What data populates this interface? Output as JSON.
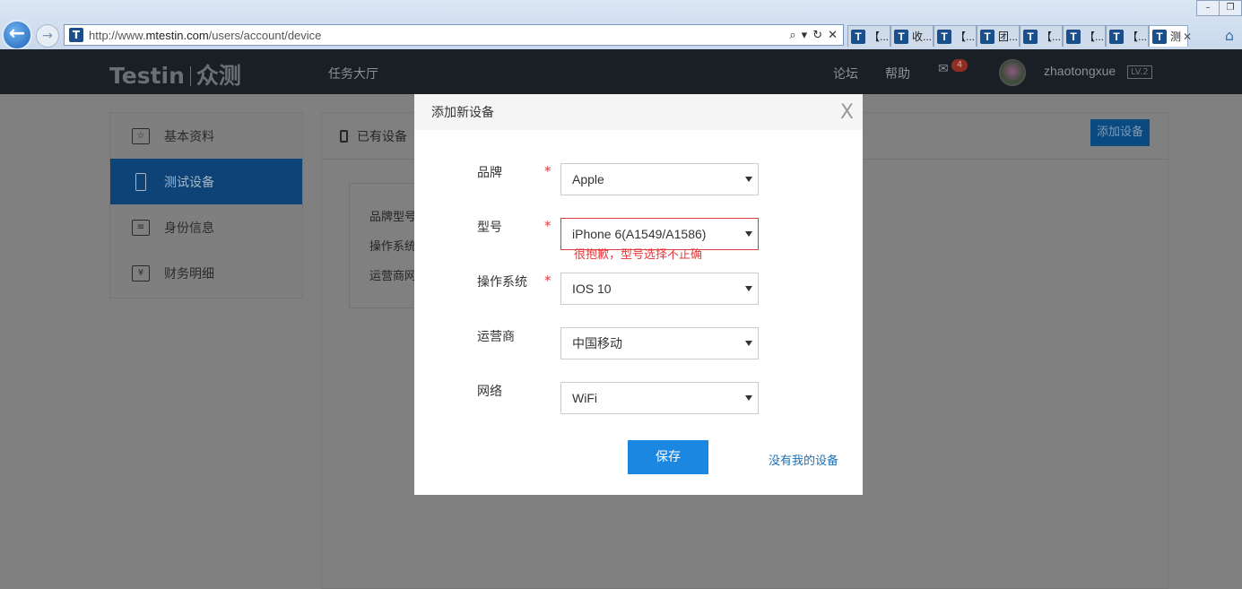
{
  "browser": {
    "url_prefix": "http://www.",
    "url_domain": "mtestin.com",
    "url_path": "/users/account/device",
    "tabs": [
      {
        "label": "【..."
      },
      {
        "label": "收..."
      },
      {
        "label": "【..."
      },
      {
        "label": "团..."
      },
      {
        "label": "【..."
      },
      {
        "label": "【..."
      },
      {
        "label": "【..."
      },
      {
        "label": "测"
      }
    ]
  },
  "header": {
    "logo_en": "Testin",
    "logo_cn": "众测",
    "nav_task": "任务大厅",
    "nav_forum": "论坛",
    "nav_help": "帮助",
    "mail_count": "4",
    "username": "zhaotongxue",
    "level": "LV.2"
  },
  "sidebar": {
    "items": [
      {
        "label": "基本资料"
      },
      {
        "label": "测试设备"
      },
      {
        "label": "身份信息"
      },
      {
        "label": "财务明细"
      }
    ]
  },
  "panel": {
    "title": "已有设备",
    "add_button": "添加设备",
    "card_lines": [
      "品牌型号",
      "操作系统",
      "运营商网"
    ]
  },
  "modal": {
    "title": "添加新设备",
    "close": "X",
    "fields": {
      "brand": {
        "label": "品牌",
        "value": "Apple",
        "required": "*"
      },
      "model": {
        "label": "型号",
        "value": "iPhone 6(A1549/A1586)",
        "required": "*",
        "error": "很抱歉，型号选择不正确"
      },
      "os": {
        "label": "操作系统",
        "value": "IOS 10",
        "required": "*"
      },
      "carrier": {
        "label": "运营商",
        "value": "中国移动"
      },
      "network": {
        "label": "网络",
        "value": "WiFi"
      }
    },
    "save_button": "保存",
    "no_device_link": "没有我的设备"
  }
}
